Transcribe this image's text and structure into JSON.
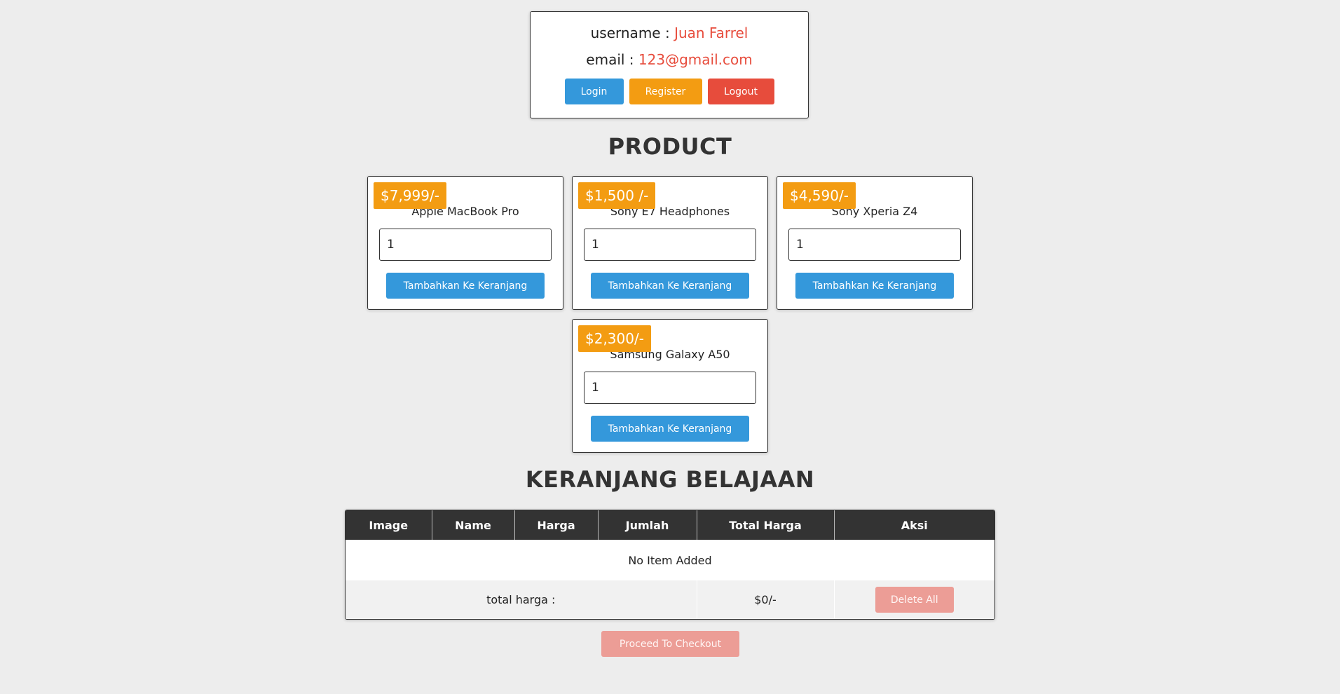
{
  "user": {
    "username_label": "username :",
    "username_value": "Juan Farrel",
    "email_label": "email :",
    "email_value": "123@gmail.com",
    "login_label": "Login",
    "register_label": "Register",
    "logout_label": "Logout"
  },
  "colors": {
    "accent_blue": "#3498db",
    "accent_orange": "#f39c12",
    "accent_red": "#e74c3c",
    "header_dark": "#333333",
    "background": "#ededed"
  },
  "products_title": "PRODUCT",
  "products": [
    {
      "price": "$7,999/-",
      "name": "Apple MacBook Pro",
      "qty": "1",
      "add_label": "Tambahkan Ke Keranjang"
    },
    {
      "price": "$1,500 /-",
      "name": "Sony E7 Headphones",
      "qty": "1",
      "add_label": "Tambahkan Ke Keranjang"
    },
    {
      "price": "$4,590/-",
      "name": "Sony Xperia Z4",
      "qty": "1",
      "add_label": "Tambahkan Ke Keranjang"
    },
    {
      "price": "$2,300/-",
      "name": "Samsung Galaxy A50",
      "qty": "1",
      "add_label": "Tambahkan Ke Keranjang"
    }
  ],
  "cart": {
    "title": "KERANJANG BELAJAAN",
    "headers": [
      "Image",
      "Name",
      "Harga",
      "Jumlah",
      "Total Harga",
      "Aksi"
    ],
    "empty_text": "No Item Added",
    "total_label": "total harga :",
    "total_value": "$0/-",
    "delete_all_label": "Delete All",
    "checkout_label": "Proceed To Checkout"
  }
}
